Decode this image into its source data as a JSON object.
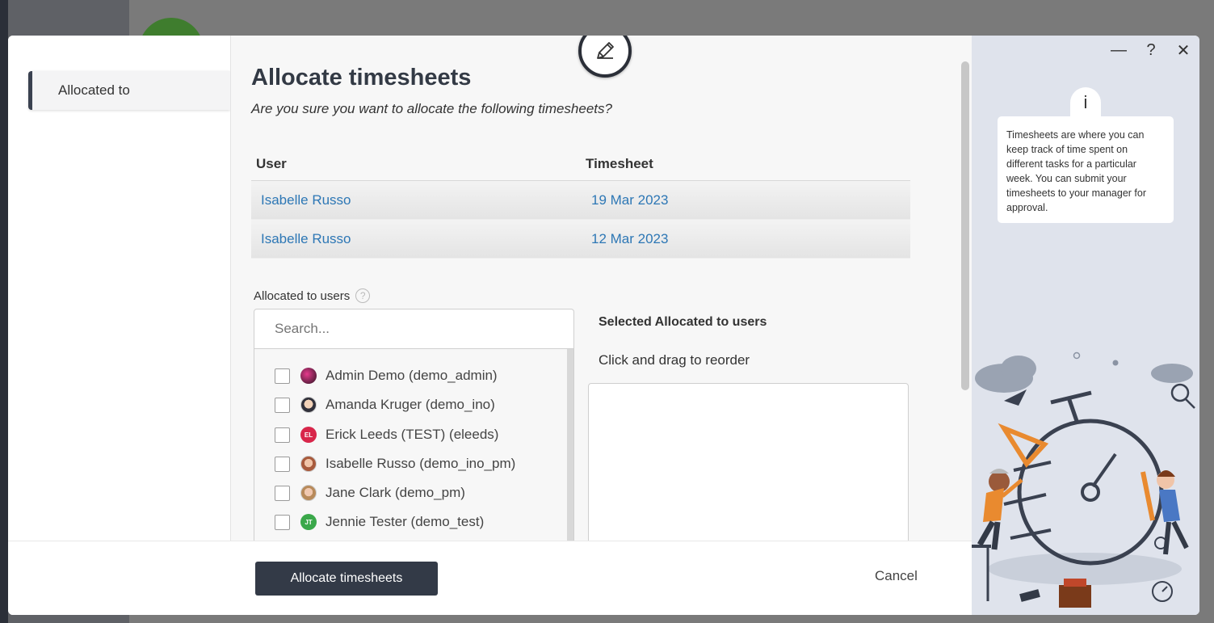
{
  "modal": {
    "nav": {
      "items": [
        {
          "label": "Allocated to"
        }
      ]
    },
    "title": "Allocate timesheets",
    "subtitle": "Are you sure you want to allocate the following timesheets?",
    "table": {
      "headers": {
        "user": "User",
        "timesheet": "Timesheet"
      },
      "rows": [
        {
          "user": "Isabelle Russo",
          "timesheet": "19 Mar 2023"
        },
        {
          "user": "Isabelle Russo",
          "timesheet": "12 Mar 2023"
        }
      ]
    },
    "allocated_users": {
      "label": "Allocated to users",
      "help_icon": "?",
      "search_placeholder": "Search...",
      "users": [
        {
          "name": "Admin Demo (demo_admin)",
          "initials": "",
          "avatar": "photo"
        },
        {
          "name": "Amanda Kruger (demo_ino)",
          "initials": "",
          "avatar": "photo"
        },
        {
          "name": "Erick Leeds (TEST) (eleeds)",
          "initials": "EL",
          "avatar": "initials"
        },
        {
          "name": "Isabelle Russo (demo_ino_pm)",
          "initials": "",
          "avatar": "photo"
        },
        {
          "name": "Jane Clark (demo_pm)",
          "initials": "",
          "avatar": "photo"
        },
        {
          "name": "Jennie Tester (demo_test)",
          "initials": "JT",
          "avatar": "initials"
        }
      ]
    },
    "selected": {
      "title": "Selected Allocated to users",
      "hint": "Click and drag to reorder"
    },
    "footer": {
      "primary_label": "Allocate timesheets",
      "cancel_label": "Cancel"
    }
  },
  "help_panel": {
    "controls": {
      "minimize": "—",
      "help": "?",
      "close": "✕"
    },
    "info_icon": "i",
    "text": "Timesheets are where you can keep track of time spent on different tasks for a particular week. You can submit your timesheets to your manager for approval."
  },
  "colors": {
    "primary": "#333a47",
    "link": "#2d77b5",
    "help_panel_bg": "#dfe3ec"
  }
}
